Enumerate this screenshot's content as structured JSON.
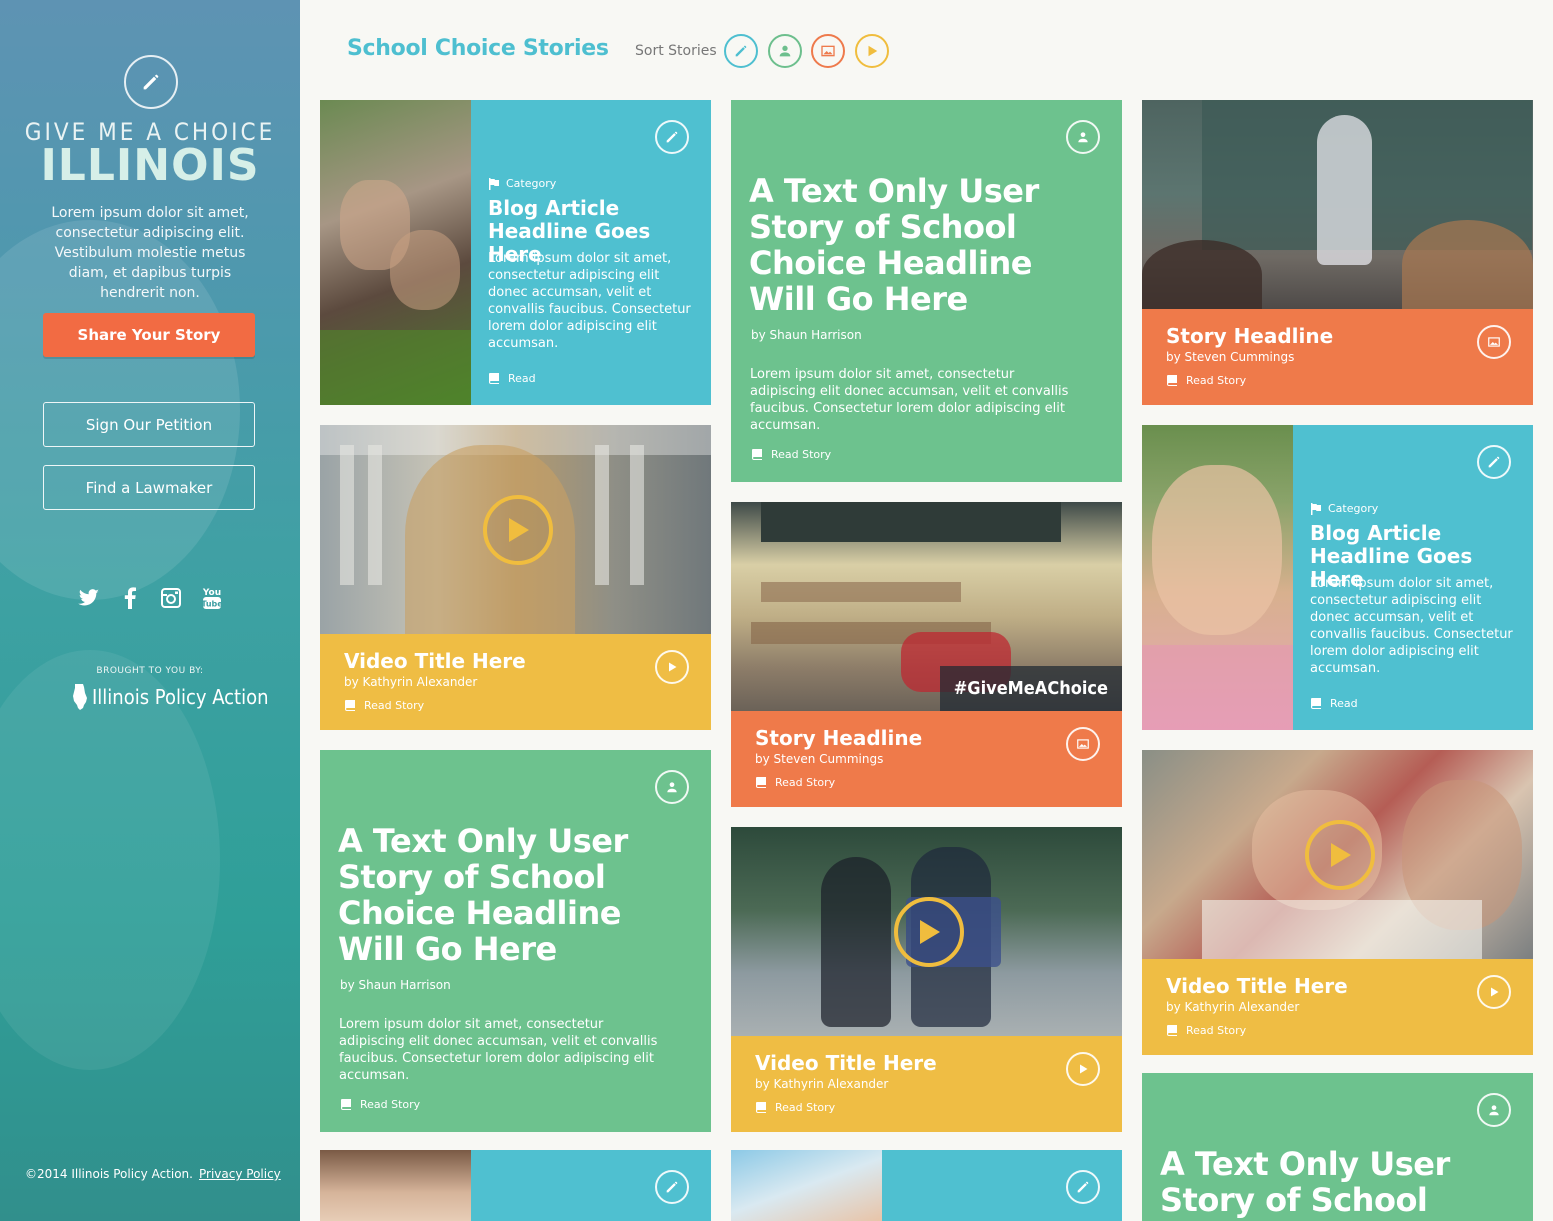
{
  "sidebar": {
    "tagline": "GIVE ME A CHOICE",
    "brand": "ILLINOIS",
    "intro": "Lorem ipsum dolor sit amet, consectetur adipiscing elit. Vestibulum molestie metus diam, et dapibus turpis hendrerit non.",
    "share_button": "Share Your Story",
    "petition_button": "Sign Our Petition",
    "lawmaker_button": "Find a Lawmaker",
    "social_icons": [
      "twitter-icon",
      "facebook-icon",
      "instagram-icon",
      "youtube-icon"
    ],
    "youtube_text": "You Tube",
    "brought_by": "BROUGHT TO YOU BY:",
    "sponsor": "Illinois Policy Action",
    "copyright": "©2014 Illinois Policy Action.",
    "privacy": "Privacy Policy"
  },
  "header": {
    "title": "School Choice Stories",
    "sort_label": "Sort Stories",
    "sort_buttons": [
      {
        "icon": "pencil-icon",
        "color": "#4ebfd0"
      },
      {
        "icon": "user-icon",
        "color": "#6dbf8d"
      },
      {
        "icon": "image-icon",
        "color": "#ee7a4c"
      },
      {
        "icon": "play-icon",
        "color": "#f0bd3e"
      }
    ]
  },
  "colors": {
    "teal": "#4fc0d0",
    "green": "#6dc28e",
    "orange": "#ef7a4a",
    "yellow": "#efbd44",
    "sidebar": "#3ea1a3"
  },
  "cards": {
    "blog1": {
      "category": "Category",
      "headline": "Blog Article Headline Goes Here",
      "body": "Lorem ipsum dolor sit amet, consectetur adipiscing elit donec accumsan, velit et convallis faucibus. Consectetur lorem dolor adipiscing elit accumsan.",
      "read": "Read",
      "photo": "students reading on grass"
    },
    "video1": {
      "headline": "Video Title Here",
      "byline": "by Kathyrin Alexander",
      "read": "Read Story",
      "photo": "smiling student outdoors"
    },
    "text1": {
      "headline": "A Text Only User Story of School Choice Headline Will Go Here",
      "byline": "by Shaun Harrison",
      "body": "Lorem ipsum dolor sit amet, consectetur adipiscing elit donec accumsan, velit et convallis faucibus. Consectetur lorem dolor adipiscing elit accumsan.",
      "read": "Read Story"
    },
    "text2": {
      "headline": "A Text Only User Story of School Choice Headline Will Go Here",
      "byline": "by Shaun Harrison",
      "body": "Lorem ipsum dolor sit amet, consectetur adipiscing elit donec accumsan, velit et convallis faucibus. Consectetur lorem dolor adipiscing elit accumsan.",
      "read": "Read Story"
    },
    "photo1": {
      "headline": "Story Headline",
      "byline": "by Steven Cummings",
      "read": "Read Story",
      "hashtag": "#GiveMeAChoice",
      "photo": "empty classroom"
    },
    "video2": {
      "headline": "Video Title Here",
      "byline": "by Kathyrin Alexander",
      "read": "Read Story",
      "photo": "two girls walking to school"
    },
    "photo2": {
      "headline": "Story Headline",
      "byline": "by Steven Cummings",
      "read": "Read Story",
      "photo": "teacher at chalkboard"
    },
    "blog2": {
      "category": "Category",
      "headline": "Blog Article Headline Goes Here",
      "body": "Lorem ipsum dolor sit amet, consectetur adipiscing elit donec accumsan, velit et convallis faucibus. Consectetur lorem dolor adipiscing elit accumsan.",
      "read": "Read",
      "photo": "smiling girl"
    },
    "video3": {
      "headline": "Video Title Here",
      "byline": "by Kathyrin Alexander",
      "read": "Read Story",
      "photo": "students writing"
    },
    "text3": {
      "headline": "A Text Only User Story of School",
      "photo": ""
    }
  }
}
